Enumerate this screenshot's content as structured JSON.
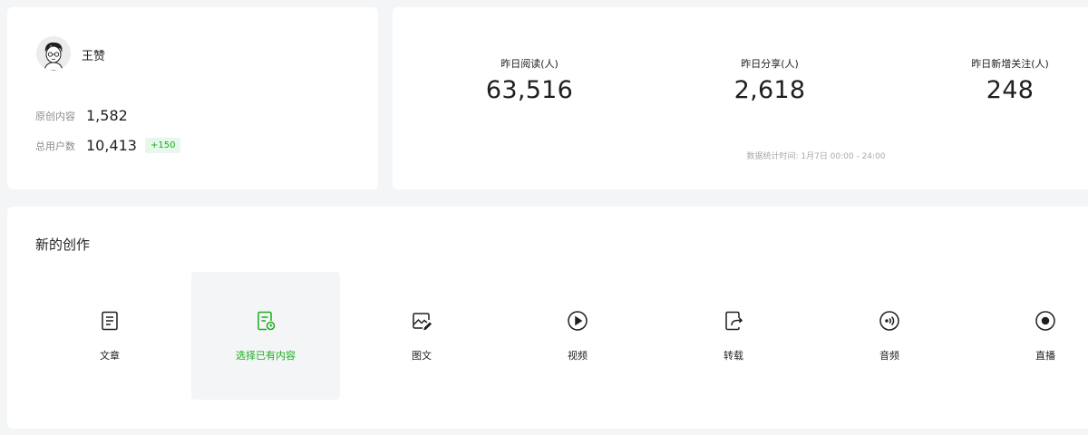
{
  "profile": {
    "name": "王赞",
    "stats": [
      {
        "label": "原创内容",
        "value": "1,582"
      },
      {
        "label": "总用户数",
        "value": "10,413",
        "badge": "+150"
      }
    ]
  },
  "yesterday": {
    "metrics": [
      {
        "label": "昨日阅读(人)",
        "value": "63,516"
      },
      {
        "label": "昨日分享(人)",
        "value": "2,618"
      },
      {
        "label": "昨日新增关注(人)",
        "value": "248"
      }
    ],
    "note": "数据统计时间: 1月7日 00:00 - 24:00"
  },
  "create": {
    "title": "新的创作",
    "items": [
      {
        "label": "文章",
        "icon": "article-icon"
      },
      {
        "label": "选择已有内容",
        "icon": "select-content-icon",
        "selected": true
      },
      {
        "label": "图文",
        "icon": "image-text-icon"
      },
      {
        "label": "视频",
        "icon": "video-play-icon"
      },
      {
        "label": "转载",
        "icon": "repost-icon"
      },
      {
        "label": "音频",
        "icon": "audio-icon"
      },
      {
        "label": "直播",
        "icon": "live-icon"
      }
    ]
  },
  "colors": {
    "accent": "#1aad19",
    "page_bg": "#f4f5f7",
    "card_bg": "#ffffff"
  }
}
